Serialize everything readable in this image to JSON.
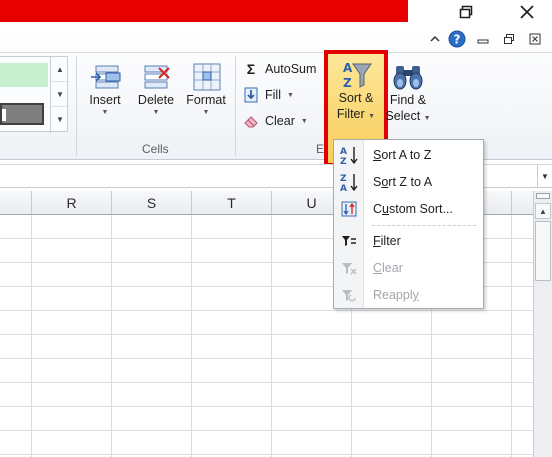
{
  "ribbon": {
    "cells_group": {
      "label": "Cells",
      "insert_label": "Insert",
      "delete_label": "Delete",
      "format_label": "Format"
    },
    "editing_group": {
      "label": "Edi",
      "autosum_label": "AutoSum",
      "fill_label": "Fill",
      "clear_label": "Clear",
      "sort_filter_label_1": "Sort &",
      "sort_filter_label_2": "Filter",
      "find_select_label_1": "Find &",
      "find_select_label_2": "Select"
    }
  },
  "columns": [
    "R",
    "S",
    "T",
    "U"
  ],
  "sort_menu": {
    "items": [
      {
        "label": "Sort A to Z",
        "accel": "S",
        "enabled": true
      },
      {
        "label": "Sort Z to A",
        "accel": "O",
        "enabled": true
      },
      {
        "label": "Custom Sort...",
        "accel": "U",
        "enabled": true
      },
      {
        "label": "Filter",
        "accel": "F",
        "enabled": true
      },
      {
        "label": "Clear",
        "accel": "C",
        "enabled": false
      },
      {
        "label": "Reapply",
        "accel": "Y",
        "enabled": false
      }
    ]
  },
  "colors": {
    "title_red": "#e60000",
    "highlight_border": "#e10000",
    "active_button": "#fbd96b"
  },
  "icons": {
    "restore": "restore-icon",
    "close": "close-icon",
    "help": "help-icon"
  }
}
